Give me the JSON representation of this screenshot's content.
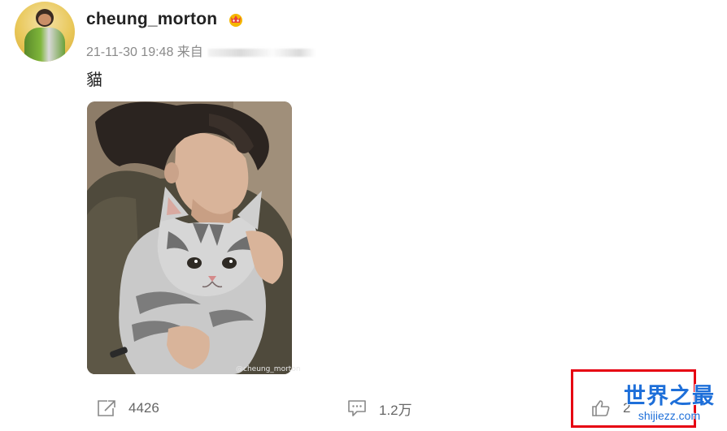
{
  "post": {
    "username": "cheung_morton",
    "badge_icon": "crown-badge-icon",
    "timestamp": "21-11-30 19:48",
    "source_prefix": "来自",
    "text": "貓",
    "image_watermark": "@cheung_morton"
  },
  "actions": {
    "repost_count": "4426",
    "comment_count": "1.2万",
    "like_count": "2"
  },
  "overlay": {
    "brand_cn": "世界之最",
    "brand_en": "shijiezz.com"
  },
  "colors": {
    "highlight_border": "#e60012",
    "brand_blue": "#1e6fd9",
    "badge_gold": "#f5b800",
    "badge_red": "#e8413c"
  }
}
